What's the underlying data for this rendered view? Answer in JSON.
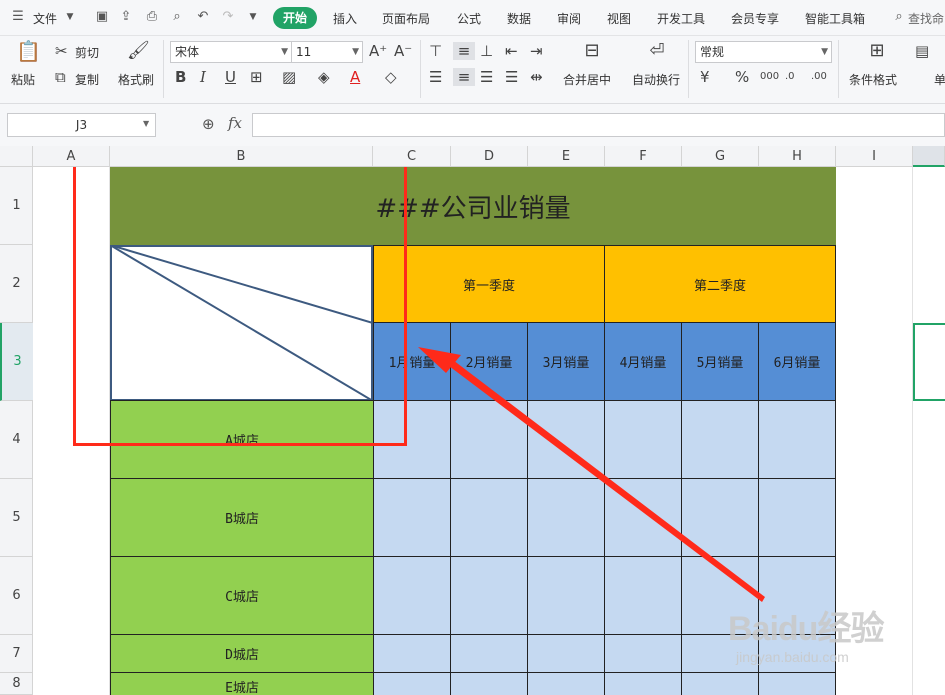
{
  "menubar": {
    "file_label": "文件",
    "tabs": [
      "开始",
      "插入",
      "页面布局",
      "公式",
      "数据",
      "审阅",
      "视图",
      "开发工具",
      "会员专享",
      "智能工具箱"
    ],
    "search_label": "查找命"
  },
  "ribbon": {
    "paste": "粘贴",
    "cut": "剪切",
    "copy": "复制",
    "format_painter": "格式刷",
    "font_name": "宋体",
    "font_size": "11",
    "merge_center": "合并居中",
    "wrap_text": "自动换行",
    "number_format": "常规",
    "conditional_format": "条件格式",
    "cell_style_partial": "单"
  },
  "formula_bar": {
    "name_box": "J3",
    "fx": "fx"
  },
  "columns": [
    "A",
    "B",
    "C",
    "D",
    "E",
    "F",
    "G",
    "H",
    "I"
  ],
  "rows": [
    "1",
    "2",
    "3",
    "4",
    "5",
    "6",
    "7",
    "8"
  ],
  "sheet": {
    "title": "###公司业销量",
    "quarters": [
      "第一季度",
      "第二季度"
    ],
    "months": [
      "1月销量",
      "2月销量",
      "3月销量",
      "4月销量",
      "5月销量",
      "6月销量"
    ],
    "stores": [
      "A城店",
      "B城店",
      "C城店",
      "D城店",
      "E城店"
    ]
  },
  "watermark": {
    "logo": "Baidu经验",
    "url": "jingyan.baidu.com"
  },
  "colors": {
    "title_fill": "#77933c",
    "quarter_fill": "#ffc000",
    "month_fill": "#558ed5",
    "store_fill": "#92d050",
    "data_fill": "#c5d9f1",
    "accent": "#21a366",
    "annotation": "#ff2a1a"
  }
}
